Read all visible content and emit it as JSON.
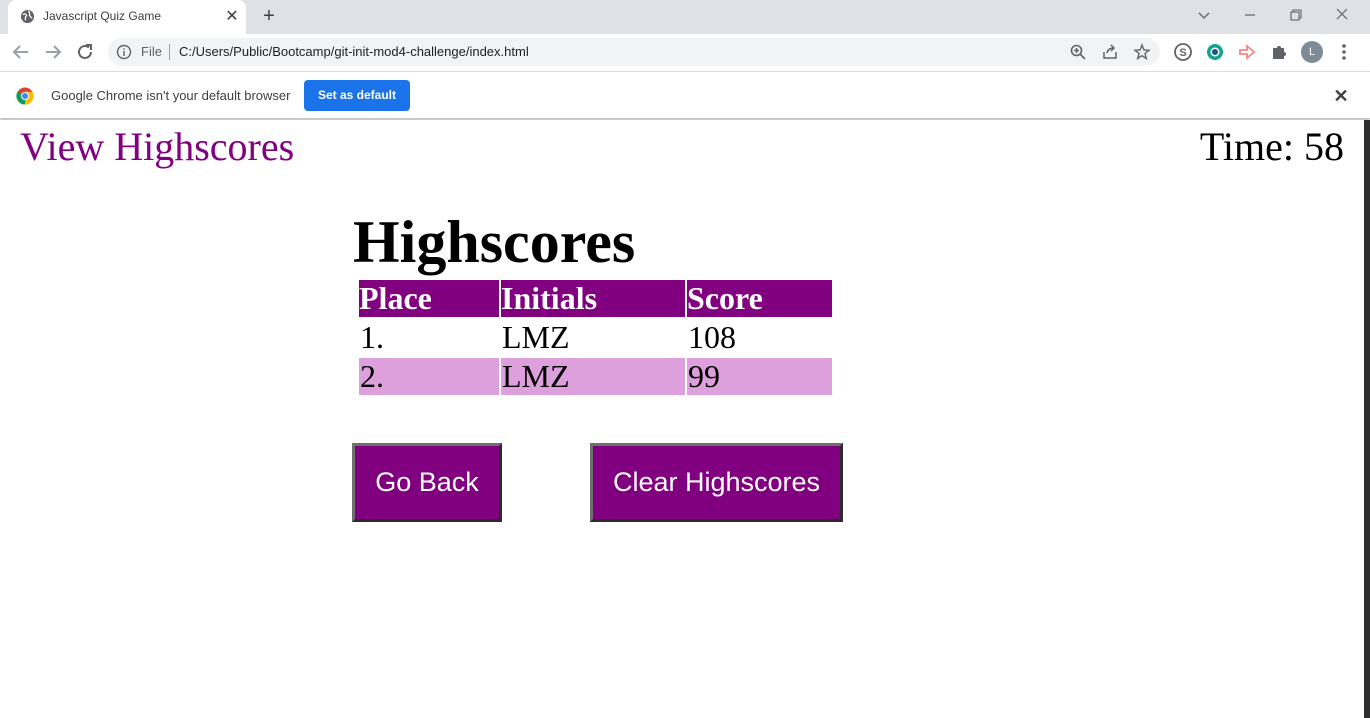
{
  "browser": {
    "tab": {
      "title": "Javascript Quiz Game"
    },
    "address": {
      "scheme_label": "File",
      "url": "C:/Users/Public/Bootcamp/git-init-mod4-challenge/index.html"
    },
    "profile_initial": "L",
    "infobar": {
      "message": "Google Chrome isn't your default browser",
      "button_label": "Set as default"
    }
  },
  "header": {
    "view_highscores_label": "View Highscores",
    "timer_text": "Time: 58"
  },
  "highscores": {
    "title": "Highscores",
    "columns": [
      "Place",
      "Initials",
      "Score"
    ],
    "rows": [
      {
        "place": "1.",
        "initials": "LMZ",
        "score": "108"
      },
      {
        "place": "2.",
        "initials": "LMZ",
        "score": "99"
      }
    ]
  },
  "buttons": {
    "go_back_label": "Go Back",
    "clear_label": "Clear Highscores"
  },
  "colors": {
    "accent": "#800080",
    "alt_row": "#dda0dd",
    "chrome_blue": "#1a73e8"
  }
}
